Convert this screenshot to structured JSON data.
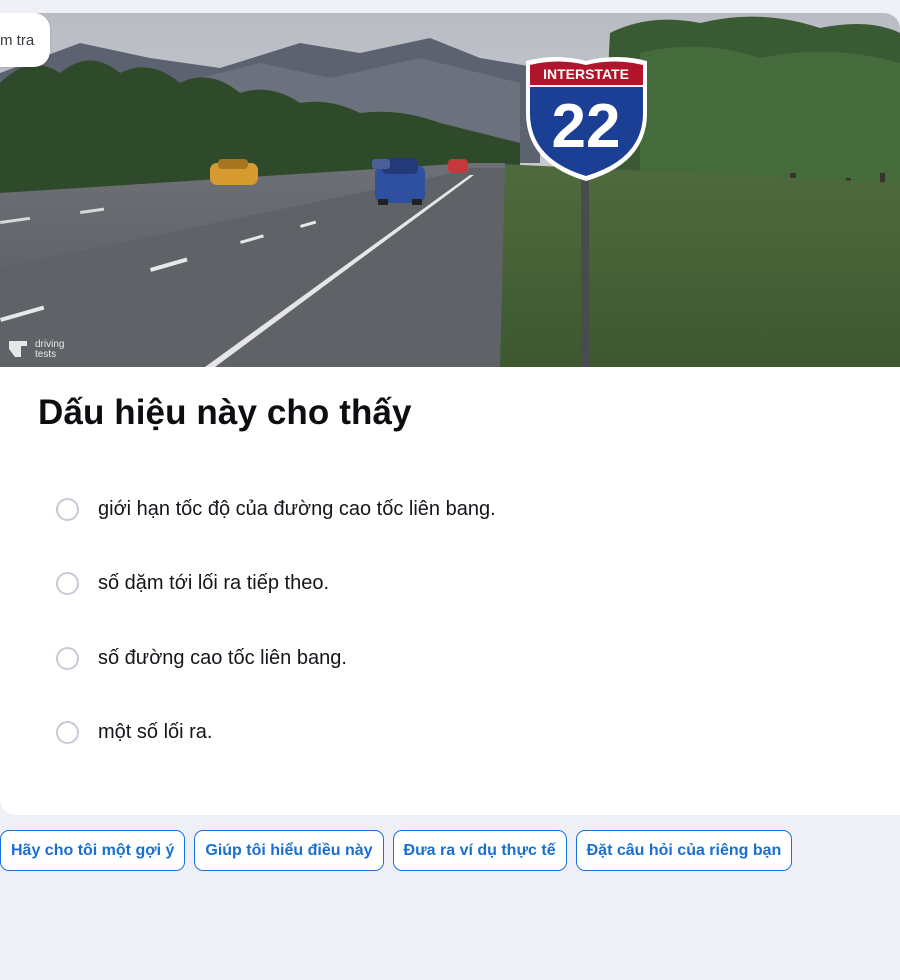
{
  "badge": {
    "label": "m tra"
  },
  "image": {
    "sign_top_text": "INTERSTATE",
    "sign_number": "22",
    "watermark_line1": "driving",
    "watermark_line2": "tests"
  },
  "question": {
    "title": "Dấu hiệu này cho thấy",
    "options": [
      {
        "label": "giới hạn tốc độ của đường cao tốc liên bang."
      },
      {
        "label": "số dặm tới lối ra tiếp theo."
      },
      {
        "label": "số đường cao tốc liên bang."
      },
      {
        "label": "một số lối ra."
      }
    ]
  },
  "suggestions": [
    {
      "label": "Hãy cho tôi một gợi ý"
    },
    {
      "label": "Giúp tôi hiểu điều này"
    },
    {
      "label": "Đưa ra ví dụ thực tế"
    },
    {
      "label": "Đặt câu hỏi của riêng bạn"
    }
  ],
  "colors": {
    "page_bg": "#eff0f6",
    "accent": "#1a73d9",
    "sign_red": "#b0152b",
    "sign_blue": "#1b3f94"
  }
}
